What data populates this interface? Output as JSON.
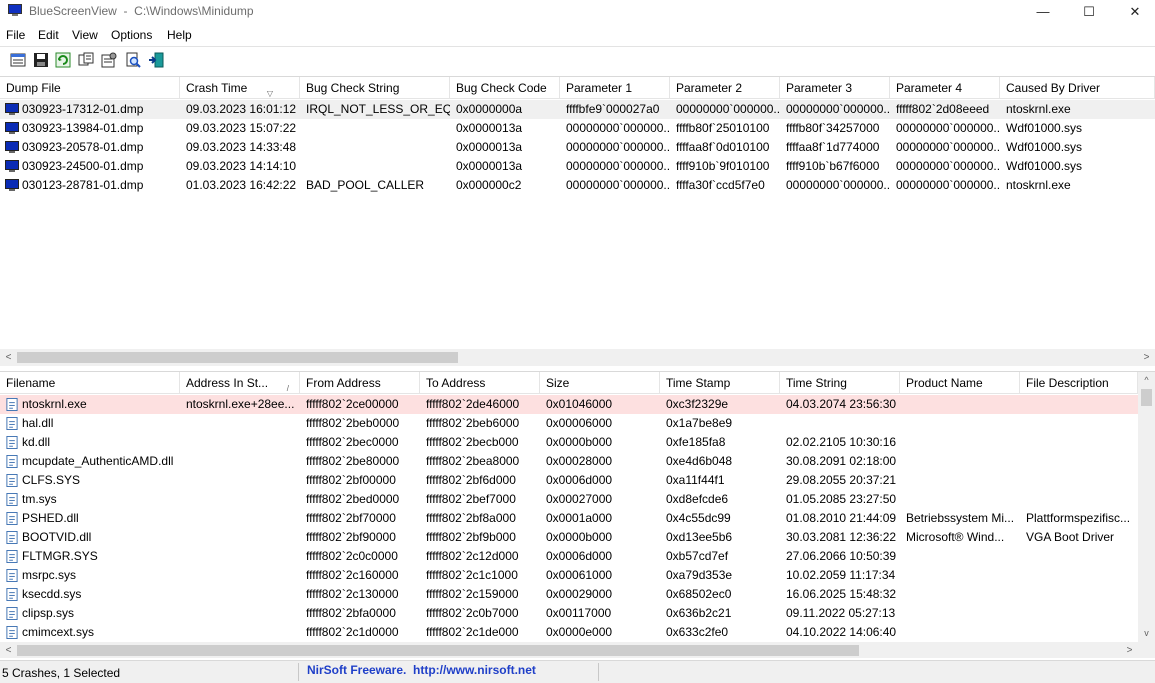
{
  "window": {
    "title": "BlueScreenView  -  C:\\Windows\\Minidump",
    "minimize_glyph": "—",
    "maximize_glyph": "☐",
    "close_glyph": "✕"
  },
  "menu": [
    "File",
    "Edit",
    "View",
    "Options",
    "Help"
  ],
  "toolbar_icons": [
    "html-report-icon",
    "save-icon",
    "refresh-icon",
    "copy-icon",
    "properties-icon",
    "find-icon",
    "exit-icon"
  ],
  "top_table": {
    "columns": [
      "Dump File",
      "Crash Time",
      "Bug Check String",
      "Bug Check Code",
      "Parameter 1",
      "Parameter 2",
      "Parameter 3",
      "Parameter 4",
      "Caused By Driver"
    ],
    "sort_indicator": "▽",
    "rows": [
      [
        "030923-17312-01.dmp",
        "09.03.2023 16:01:12",
        "IRQL_NOT_LESS_OR_EQ...",
        "0x0000000a",
        "ffffbfe9`000027a0",
        "00000000`000000...",
        "00000000`000000...",
        "fffff802`2d08eeed",
        "ntoskrnl.exe"
      ],
      [
        "030923-13984-01.dmp",
        "09.03.2023 15:07:22",
        "",
        "0x0000013a",
        "00000000`000000...",
        "ffffb80f`25010100",
        "ffffb80f`34257000",
        "00000000`000000...",
        "Wdf01000.sys"
      ],
      [
        "030923-20578-01.dmp",
        "09.03.2023 14:33:48",
        "",
        "0x0000013a",
        "00000000`000000...",
        "ffffaa8f`0d010100",
        "ffffaa8f`1d774000",
        "00000000`000000...",
        "Wdf01000.sys"
      ],
      [
        "030923-24500-01.dmp",
        "09.03.2023 14:14:10",
        "",
        "0x0000013a",
        "00000000`000000...",
        "ffff910b`9f010100",
        "ffff910b`b67f6000",
        "00000000`000000...",
        "Wdf01000.sys"
      ],
      [
        "030123-28781-01.dmp",
        "01.03.2023 16:42:22",
        "BAD_POOL_CALLER",
        "0x000000c2",
        "00000000`000000...",
        "ffffa30f`ccd5f7e0",
        "00000000`000000...",
        "00000000`000000...",
        "ntoskrnl.exe"
      ]
    ]
  },
  "bottom_table": {
    "columns": [
      "Filename",
      "Address In St...",
      "From Address",
      "To Address",
      "Size",
      "Time Stamp",
      "Time String",
      "Product Name",
      "File Description"
    ],
    "sort_indicator": "/",
    "rows": [
      [
        "ntoskrnl.exe",
        "ntoskrnl.exe+28ee...",
        "fffff802`2ce00000",
        "fffff802`2de46000",
        "0x01046000",
        "0xc3f2329e",
        "04.03.2074 23:56:30",
        "",
        ""
      ],
      [
        "hal.dll",
        "",
        "fffff802`2beb0000",
        "fffff802`2beb6000",
        "0x00006000",
        "0x1a7be8e9",
        "",
        "",
        ""
      ],
      [
        "kd.dll",
        "",
        "fffff802`2bec0000",
        "fffff802`2becb000",
        "0x0000b000",
        "0xfe185fa8",
        "02.02.2105 10:30:16",
        "",
        ""
      ],
      [
        "mcupdate_AuthenticAMD.dll",
        "",
        "fffff802`2be80000",
        "fffff802`2bea8000",
        "0x00028000",
        "0xe4d6b048",
        "30.08.2091 02:18:00",
        "",
        ""
      ],
      [
        "CLFS.SYS",
        "",
        "fffff802`2bf00000",
        "fffff802`2bf6d000",
        "0x0006d000",
        "0xa11f44f1",
        "29.08.2055 20:37:21",
        "",
        ""
      ],
      [
        "tm.sys",
        "",
        "fffff802`2bed0000",
        "fffff802`2bef7000",
        "0x00027000",
        "0xd8efcde6",
        "01.05.2085 23:27:50",
        "",
        ""
      ],
      [
        "PSHED.dll",
        "",
        "fffff802`2bf70000",
        "fffff802`2bf8a000",
        "0x0001a000",
        "0x4c55dc99",
        "01.08.2010 21:44:09",
        "Betriebssystem Mi...",
        "Plattformspezifisc..."
      ],
      [
        "BOOTVID.dll",
        "",
        "fffff802`2bf90000",
        "fffff802`2bf9b000",
        "0x0000b000",
        "0xd13ee5b6",
        "30.03.2081 12:36:22",
        "Microsoft® Wind...",
        "VGA Boot Driver"
      ],
      [
        "FLTMGR.SYS",
        "",
        "fffff802`2c0c0000",
        "fffff802`2c12d000",
        "0x0006d000",
        "0xb57cd7ef",
        "27.06.2066 10:50:39",
        "",
        ""
      ],
      [
        "msrpc.sys",
        "",
        "fffff802`2c160000",
        "fffff802`2c1c1000",
        "0x00061000",
        "0xa79d353e",
        "10.02.2059 11:17:34",
        "",
        ""
      ],
      [
        "ksecdd.sys",
        "",
        "fffff802`2c130000",
        "fffff802`2c159000",
        "0x00029000",
        "0x68502ec0",
        "16.06.2025 15:48:32",
        "",
        ""
      ],
      [
        "clipsp.sys",
        "",
        "fffff802`2bfa0000",
        "fffff802`2c0b7000",
        "0x00117000",
        "0x636b2c21",
        "09.11.2022 05:27:13",
        "",
        ""
      ],
      [
        "cmimcext.sys",
        "",
        "fffff802`2c1d0000",
        "fffff802`2c1de000",
        "0x0000e000",
        "0x633c2fe0",
        "04.10.2022 14:06:40",
        "",
        ""
      ]
    ]
  },
  "scroll_arrows": {
    "left": "<",
    "right": ">",
    "up": "^",
    "down": "v"
  },
  "status": {
    "count_text": "5 Crashes, 1 Selected",
    "link_text": "NirSoft Freeware.  http://www.nirsoft.net"
  },
  "colors": {
    "selected_top_row": "#f0f0f0",
    "selected_bottom_row": "#fde0e0",
    "link": "#1f3fc8",
    "dump_icon": "#0a2bb5"
  }
}
